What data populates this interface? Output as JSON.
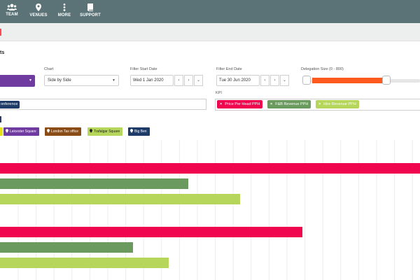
{
  "nav": {
    "items": [
      {
        "id": "team",
        "label": "TEAM",
        "icon": "team-icon"
      },
      {
        "id": "venues",
        "label": "VENUES",
        "icon": "location-pin-icon"
      },
      {
        "id": "more",
        "label": "MORE",
        "icon": "more-vertical-icon"
      },
      {
        "id": "support",
        "label": "SUPPORT",
        "icon": "book-icon"
      }
    ]
  },
  "page": {
    "heading_fragment": "ts"
  },
  "filters": {
    "chart_label": "Chart",
    "chart_value": "Side by Side",
    "start_date_label": "Filter Start Date",
    "start_date_value": "Wed 1 Jan 2020",
    "end_date_label": "Filter End Date",
    "end_date_value": "Tue 30 Jun 2020",
    "date_prev": "‹",
    "date_next": "›",
    "date_expand": "⌄",
    "delegation_label": "Delegation Size (0 - 800)",
    "delegation_range": [
      100,
      700
    ],
    "kpi_label": "KPI"
  },
  "venue_tag": "onference",
  "kpi_tags": [
    {
      "label": "Price Per Head PPH",
      "color": "#f0064f"
    },
    {
      "label": "F&B Revenue PPH",
      "color": "#6b9a5e"
    },
    {
      "label": "Hire Revenue PPH",
      "color": "#b6d55b"
    }
  ],
  "legend": [
    {
      "label": "Leicester Square",
      "color": "#6f3ba0"
    },
    {
      "label": "London Tax office",
      "color": "#8a4c16"
    },
    {
      "label": "Trafalgar Square",
      "color": "#b6d55b"
    },
    {
      "label": "Big Ben",
      "color": "#1f3c68"
    }
  ],
  "chart_data": {
    "type": "bar",
    "orientation": "horizontal",
    "grid": true,
    "series": [
      {
        "name": "Price Per Head PPH",
        "color": "#f0064f",
        "values": [
          1.0,
          0.72
        ]
      },
      {
        "name": "F&B Revenue PPH",
        "color": "#6b9a5e",
        "values": [
          0.448,
          0.317
        ]
      },
      {
        "name": "Hire Revenue PPH",
        "color": "#b6d55b",
        "values": [
          0.572,
          0.402
        ]
      }
    ]
  }
}
